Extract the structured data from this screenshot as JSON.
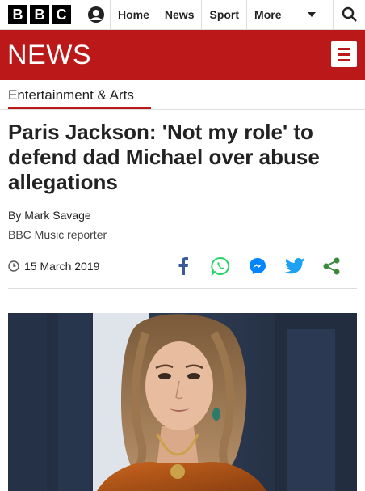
{
  "header": {
    "logo_letters": [
      "B",
      "B",
      "C"
    ],
    "nav": [
      "Home",
      "News",
      "Sport",
      "More"
    ],
    "icons": [
      "account-icon",
      "chevron-down-icon",
      "search-icon"
    ]
  },
  "banner": {
    "title": "NEWS",
    "menu_icon": "hamburger-menu-icon",
    "color": "#bb1919"
  },
  "article": {
    "section": "Entertainment & Arts",
    "headline": "Paris Jackson: 'Not my role' to defend dad Michael over abuse allegations",
    "byline": "By Mark Savage",
    "role": "BBC Music reporter",
    "date": "15 March 2019",
    "share_icons": [
      "facebook-icon",
      "whatsapp-icon",
      "messenger-icon",
      "twitter-icon",
      "share-icon"
    ]
  },
  "colors": {
    "accent": "#bb1919",
    "facebook": "#3b5998",
    "whatsapp": "#25d366",
    "messenger": "#0084ff",
    "twitter": "#1da1f2",
    "share": "#3a8a3a"
  }
}
